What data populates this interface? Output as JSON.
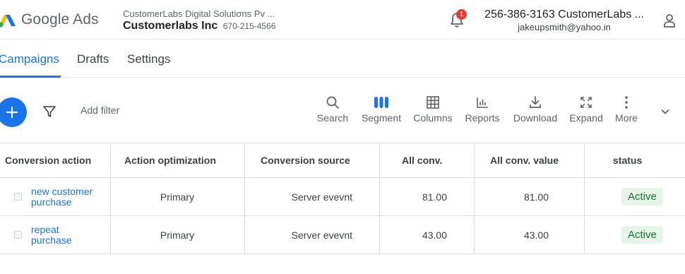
{
  "header": {
    "logo_text": "Google Ads",
    "account_sub": "CustomerLabs Digital Solutiσns Pv ...",
    "account_name": "Customerlabs Inc",
    "account_id": "670-215-4566",
    "notification_count": "1",
    "user_top": "256-386-3163 CustomerLabs ...",
    "user_email": "jakeupsmith@yahoo.in"
  },
  "tabs": [
    {
      "label": "Campaigns",
      "active": true
    },
    {
      "label": "Drafts",
      "active": false
    },
    {
      "label": "Settings",
      "active": false
    }
  ],
  "toolbar": {
    "add_filter": "Add filter",
    "tools": [
      {
        "label": "Search",
        "icon": "search-icon"
      },
      {
        "label": "Segment",
        "icon": "segment-icon"
      },
      {
        "label": "Columns",
        "icon": "columns-icon"
      },
      {
        "label": "Reports",
        "icon": "reports-icon"
      },
      {
        "label": "Download",
        "icon": "download-icon"
      },
      {
        "label": "Expand",
        "icon": "expand-icon"
      },
      {
        "label": "More",
        "icon": "more-icon"
      }
    ]
  },
  "table": {
    "headers": [
      "Conversion action",
      "Action optimization",
      "Conversion source",
      "All conv.",
      "All conv. value",
      "status"
    ],
    "rows": [
      {
        "action": "new customer purchase",
        "optimization": "Primary",
        "source": "Server evevnt",
        "conv": "81.00",
        "value": "81.00",
        "status": "Active"
      },
      {
        "action": "repeat purchase",
        "optimization": "Primary",
        "source": "Server evevnt",
        "conv": "43.00",
        "value": "43.00",
        "status": "Active"
      }
    ]
  },
  "colors": {
    "accent": "#1a73e8",
    "active_badge_bg": "#e6f4ea",
    "active_badge_text": "#137333",
    "notification": "#e53935"
  }
}
